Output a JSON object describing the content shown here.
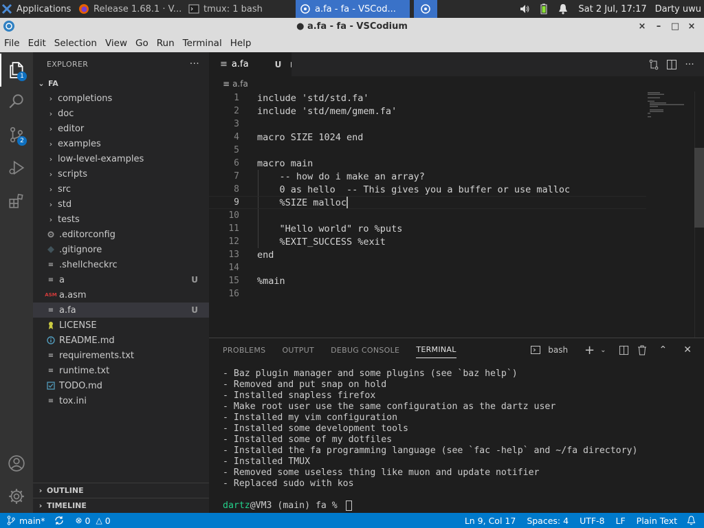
{
  "taskbar": {
    "applications_label": "Applications",
    "windows": [
      {
        "label": "Release 1.68.1 · V..."
      },
      {
        "label": "tmux: 1 bash"
      },
      {
        "label": "a.fa - fa - VSCod..."
      }
    ],
    "clock": "Sat  2 Jul, 17:17",
    "username": "Darty uwu"
  },
  "window": {
    "title": "● a.fa - fa - VSCodium",
    "controls": [
      "×",
      "–",
      "□",
      "×"
    ]
  },
  "menu": [
    "File",
    "Edit",
    "Selection",
    "View",
    "Go",
    "Run",
    "Terminal",
    "Help"
  ],
  "activity_bar": {
    "explorer_badge": "1",
    "scm_badge": "2"
  },
  "explorer": {
    "title": "EXPLORER",
    "more": "···",
    "root": "FA",
    "folders": [
      "completions",
      "doc",
      "editor",
      "examples",
      "low-level-examples",
      "scripts",
      "src",
      "std",
      "tests"
    ],
    "files": [
      {
        "name": ".editorconfig",
        "icon": "gear-icon",
        "git": ""
      },
      {
        "name": ".gitignore",
        "icon": "diamond-icon",
        "git": ""
      },
      {
        "name": ".shellcheckrc",
        "icon": "lines-icon",
        "git": ""
      },
      {
        "name": "a",
        "icon": "lines-icon",
        "git": "U"
      },
      {
        "name": "a.asm",
        "icon": "asm-icon",
        "icon_text": "ASM",
        "git": ""
      },
      {
        "name": "a.fa",
        "icon": "lines-icon",
        "git": "U"
      },
      {
        "name": "LICENSE",
        "icon": "license-icon",
        "git": ""
      },
      {
        "name": "README.md",
        "icon": "info-icon",
        "git": ""
      },
      {
        "name": "requirements.txt",
        "icon": "lines-icon",
        "git": ""
      },
      {
        "name": "runtime.txt",
        "icon": "lines-icon",
        "git": ""
      },
      {
        "name": "TODO.md",
        "icon": "todo-icon",
        "git": ""
      },
      {
        "name": "tox.ini",
        "icon": "lines-icon",
        "git": ""
      }
    ],
    "outline": "OUTLINE",
    "timeline": "TIMELINE"
  },
  "editor": {
    "tab_label": "a.fa",
    "tab_status": "U",
    "breadcrumb": "a.fa",
    "current_line": 9,
    "lines": [
      "include 'std/std.fa'",
      "include 'std/mem/gmem.fa'",
      "",
      "macro SIZE 1024 end",
      "",
      "macro main",
      "    -- how do i make an array?",
      "    0 as hello  -- This gives you a buffer or use malloc",
      "    %SIZE malloc",
      "",
      "    \"Hello world\" ro %puts",
      "    %EXIT_SUCCESS %exit",
      "end",
      "",
      "%main",
      ""
    ]
  },
  "panel": {
    "tabs": [
      "PROBLEMS",
      "OUTPUT",
      "DEBUG CONSOLE",
      "TERMINAL"
    ],
    "active_tab": "TERMINAL",
    "shell": "bash",
    "terminal_lines": [
      "- Baz plugin manager and some plugins (see `baz help`)",
      "- Removed and put snap on hold",
      "- Installed snapless firefox",
      "- Make root user use the same configuration as the dartz user",
      "- Installed my vim configuration",
      "- Installed some development tools",
      "- Installed some of my dotfiles",
      "- Installed the fa programming language (see `fac -help` and ~/fa directory)",
      "- Installed TMUX",
      "- Removed some useless thing like muon and update notifier",
      "- Replaced sudo with kos"
    ],
    "prompt_user": "dartz",
    "prompt_rest": "@VM3 (main) fa % "
  },
  "statusbar": {
    "branch": "main*",
    "errors": "0",
    "warnings": "0",
    "position": "Ln 9, Col 17",
    "spaces": "Spaces: 4",
    "encoding": "UTF-8",
    "eol": "LF",
    "language": "Plain Text",
    "color": "#007acc"
  }
}
